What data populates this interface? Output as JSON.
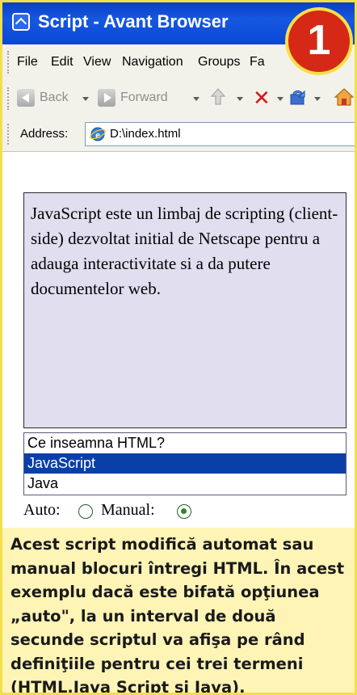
{
  "window": {
    "title": "Script - Avant Browser"
  },
  "badge": {
    "number": "1"
  },
  "menu": [
    "File",
    "Edit",
    "View",
    "Navigation",
    "Groups",
    "Fa"
  ],
  "toolbar": {
    "back_label": "Back",
    "forward_label": "Forward",
    "icons": [
      "back-arrow-icon",
      "forward-arrow-icon",
      "up-folder-icon",
      "stop-icon",
      "refresh-icon",
      "home-icon"
    ]
  },
  "address": {
    "label": "Address:",
    "value": "D:\\index.html"
  },
  "page": {
    "description": "JavaScript este un limbaj de scripting (client-side) dezvoltat initial de Netscape pentru a adauga interactivitate si a da putere documentelor web.",
    "options": [
      "Ce inseamna HTML?",
      "JavaScript",
      "Java"
    ],
    "selected_option": "JavaScript",
    "mode": {
      "auto_label": "Auto:",
      "manual_label": "Manual:",
      "selected": "Manual"
    }
  },
  "caption": {
    "text": "Acest script modifică automat sau manual blocuri întregi HTML. În acest exemplu dacă este bifată opţiunea „auto\", la un interval de două secunde scriptul va afişa pe rând definiţiile pentru cei trei termeni (HTML,Java Script şi Java)."
  },
  "colors": {
    "titlebar": "#0a47d6",
    "badge": "#d62817",
    "frame_border": "#f2df4a",
    "text_box_bg": "#e0deef",
    "selected_option_bg": "#0a3fa8",
    "caption_bg": "#fdf4b6"
  }
}
